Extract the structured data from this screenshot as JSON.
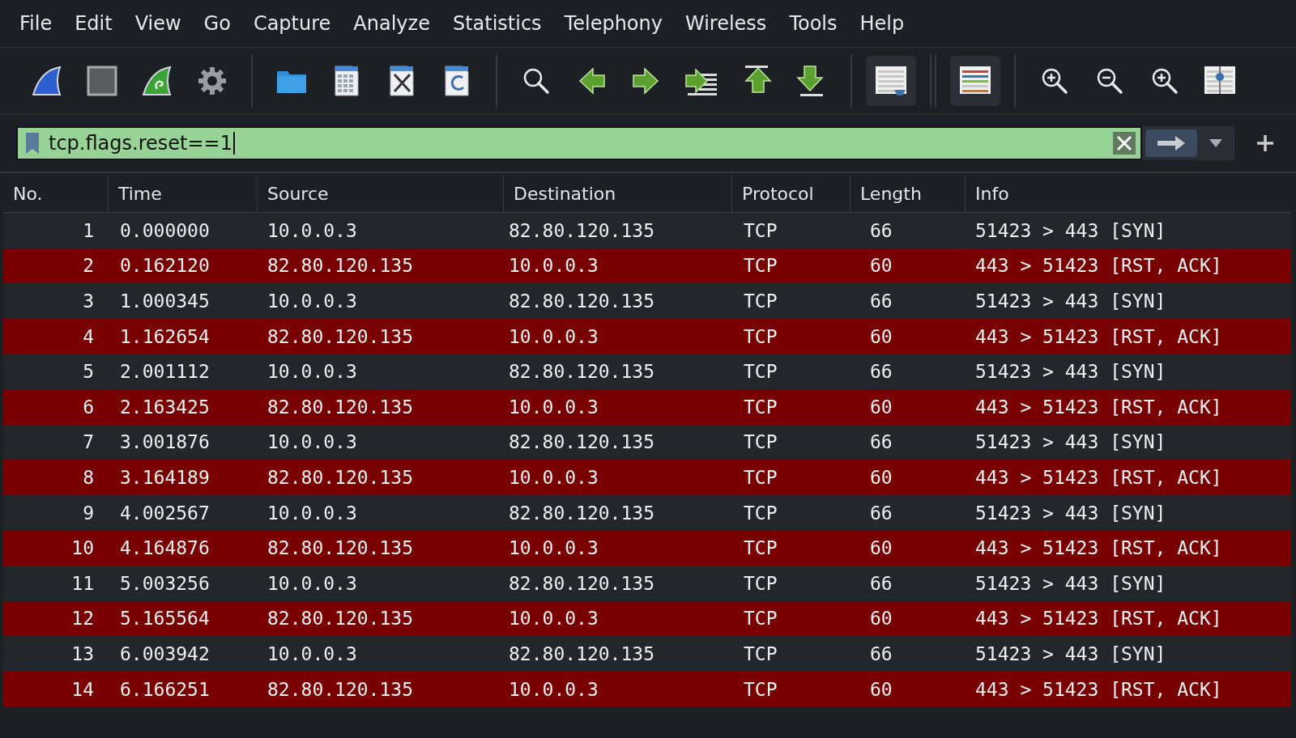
{
  "menu": [
    "File",
    "Edit",
    "View",
    "Go",
    "Capture",
    "Analyze",
    "Statistics",
    "Telephony",
    "Wireless",
    "Tools",
    "Help"
  ],
  "toolbar": {
    "buttons": [
      {
        "on": false
      },
      {
        "on": false
      },
      {
        "on": false
      },
      {
        "on": false
      },
      {
        "on": false
      },
      {
        "on": false
      },
      {
        "on": false
      },
      {
        "on": false
      },
      {
        "on": false
      },
      {
        "on": false
      },
      {
        "on": false
      },
      {
        "on": false
      },
      {
        "on": false
      },
      {
        "on": false
      },
      {
        "on": true
      },
      {
        "on": true
      },
      {
        "on": false
      },
      {
        "on": false
      },
      {
        "on": false
      },
      {
        "on": false
      }
    ]
  },
  "filter": {
    "value": "tcp.flags.reset==1",
    "valid": true
  },
  "table": {
    "columns": [
      "No.",
      "Time",
      "Source",
      "Destination",
      "Protocol",
      "Length",
      "Info"
    ],
    "rows": [
      {
        "cells": [
          "1",
          "0.000000",
          "10.0.0.3",
          "82.80.120.135",
          "TCP",
          "66",
          "51423 > 443 [SYN]"
        ],
        "color": "#23272c"
      },
      {
        "cells": [
          "2",
          "0.162120",
          "82.80.120.135",
          "10.0.0.3",
          "TCP",
          "60",
          "443 > 51423 [RST, ACK]"
        ],
        "color": "#780000"
      },
      {
        "cells": [
          "3",
          "1.000345",
          "10.0.0.3",
          "82.80.120.135",
          "TCP",
          "66",
          "51423 > 443 [SYN]"
        ],
        "color": "#23272c"
      },
      {
        "cells": [
          "4",
          "1.162654",
          "82.80.120.135",
          "10.0.0.3",
          "TCP",
          "60",
          "443 > 51423 [RST, ACK]"
        ],
        "color": "#780000"
      },
      {
        "cells": [
          "5",
          "2.001112",
          "10.0.0.3",
          "82.80.120.135",
          "TCP",
          "66",
          "51423 > 443 [SYN]"
        ],
        "color": "#23272c"
      },
      {
        "cells": [
          "6",
          "2.163425",
          "82.80.120.135",
          "10.0.0.3",
          "TCP",
          "60",
          "443 > 51423 [RST, ACK]"
        ],
        "color": "#780000"
      },
      {
        "cells": [
          "7",
          "3.001876",
          "10.0.0.3",
          "82.80.120.135",
          "TCP",
          "66",
          "51423 > 443 [SYN]"
        ],
        "color": "#23272c"
      },
      {
        "cells": [
          "8",
          "3.164189",
          "82.80.120.135",
          "10.0.0.3",
          "TCP",
          "60",
          "443 > 51423 [RST, ACK]"
        ],
        "color": "#780000"
      },
      {
        "cells": [
          "9",
          "4.002567",
          "10.0.0.3",
          "82.80.120.135",
          "TCP",
          "66",
          "51423 > 443 [SYN]"
        ],
        "color": "#23272c"
      },
      {
        "cells": [
          "10",
          "4.164876",
          "82.80.120.135",
          "10.0.0.3",
          "TCP",
          "60",
          "443 > 51423 [RST, ACK]"
        ],
        "color": "#780000"
      },
      {
        "cells": [
          "11",
          "5.003256",
          "10.0.0.3",
          "82.80.120.135",
          "TCP",
          "66",
          "51423 > 443 [SYN]"
        ],
        "color": "#23272c"
      },
      {
        "cells": [
          "12",
          "5.165564",
          "82.80.120.135",
          "10.0.0.3",
          "TCP",
          "60",
          "443 > 51423 [RST, ACK]"
        ],
        "color": "#780000"
      },
      {
        "cells": [
          "13",
          "6.003942",
          "10.0.0.3",
          "82.80.120.135",
          "TCP",
          "66",
          "51423 > 443 [SYN]"
        ],
        "color": "#23272c"
      },
      {
        "cells": [
          "14",
          "6.166251",
          "82.80.120.135",
          "10.0.0.3",
          "TCP",
          "60",
          "443 > 51423 [RST, ACK]"
        ],
        "color": "#780000"
      }
    ]
  }
}
